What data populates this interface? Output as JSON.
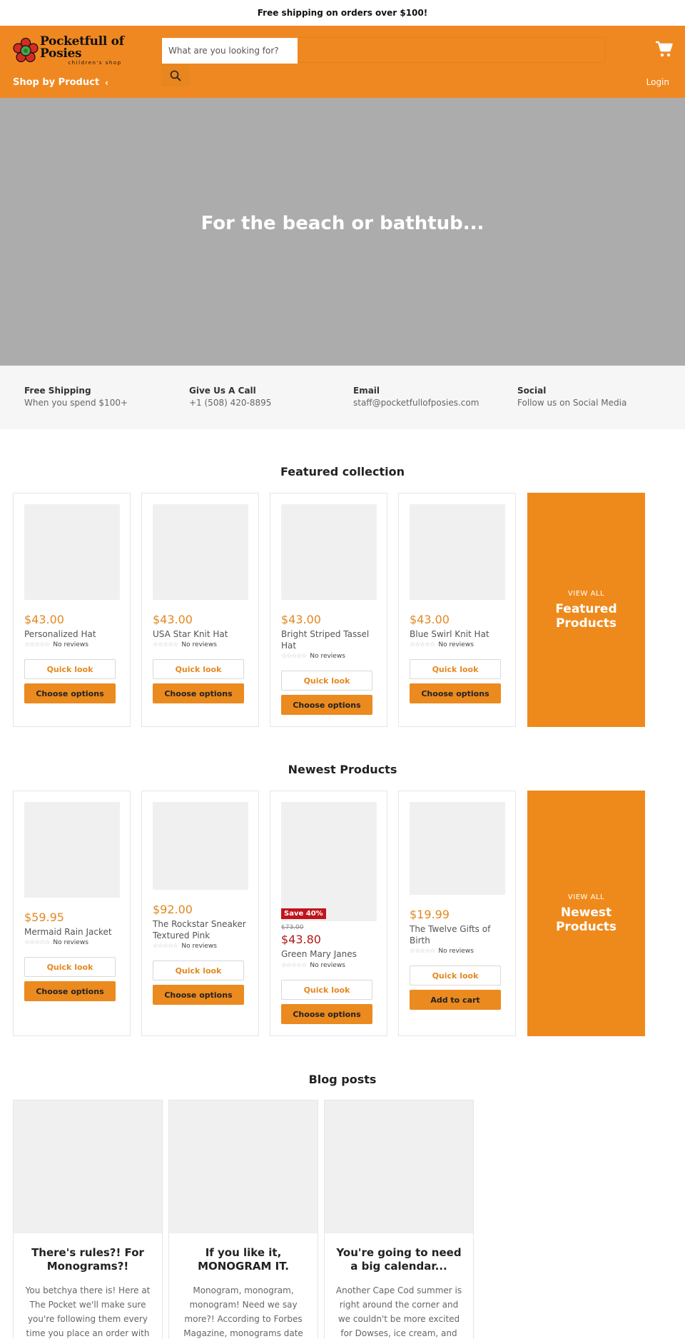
{
  "announcement": "Free shipping on orders over $100!",
  "header": {
    "logo_main": "Pocketfull of Posies",
    "logo_sub": "children's shop",
    "search_placeholder": "What are you looking for?",
    "nav_shop": "Shop by Product",
    "nav_login": "Login"
  },
  "hero": {
    "title": "For the beach or bathtub..."
  },
  "features": [
    {
      "title": "Free Shipping",
      "sub": "When you spend $100+"
    },
    {
      "title": "Give Us A Call",
      "sub": "+1 (508) 420-8895"
    },
    {
      "title": "Email",
      "sub": "staff@pocketfullofposies.com"
    },
    {
      "title": "Social",
      "sub": "Follow us on Social Media"
    }
  ],
  "featured": {
    "title": "Featured collection",
    "products": [
      {
        "price": "$43.00",
        "name": "Personalized Hat",
        "reviews": "No reviews",
        "quick": "Quick look",
        "action": "Choose options"
      },
      {
        "price": "$43.00",
        "name": "USA Star Knit Hat",
        "reviews": "No reviews",
        "quick": "Quick look",
        "action": "Choose options"
      },
      {
        "price": "$43.00",
        "name": "Bright Striped Tassel Hat",
        "reviews": "No reviews",
        "quick": "Quick look",
        "action": "Choose options"
      },
      {
        "price": "$43.00",
        "name": "Blue Swirl Knit Hat",
        "reviews": "No reviews",
        "quick": "Quick look",
        "action": "Choose options"
      }
    ],
    "promo_view_all": "VIEW ALL",
    "promo_title": "Featured Products"
  },
  "newest": {
    "title": "Newest Products",
    "products": [
      {
        "price": "$59.95",
        "name": "Mermaid Rain Jacket",
        "reviews": "No reviews",
        "quick": "Quick look",
        "action": "Choose options"
      },
      {
        "price": "$92.00",
        "name": "The Rockstar Sneaker Textured Pink",
        "reviews": "No reviews",
        "quick": "Quick look",
        "action": "Choose options"
      },
      {
        "badge": "Save 40%",
        "compare": "$73.00",
        "price": "$43.80",
        "name": "Green Mary Janes",
        "reviews": "No reviews",
        "quick": "Quick look",
        "action": "Choose options"
      },
      {
        "price": "$19.99",
        "name": "The Twelve Gifts of Birth",
        "reviews": "No reviews",
        "quick": "Quick look",
        "action": "Add to cart"
      }
    ],
    "promo_view_all": "VIEW ALL",
    "promo_title": "Newest Products"
  },
  "blog": {
    "title": "Blog posts",
    "posts": [
      {
        "title": "There's rules?! For Monograms?!",
        "excerpt": "You betchya there is! Here at The Pocket we'll make sure you're following them every time you place an order with"
      },
      {
        "title": "If you like it, MONOGRAM IT.",
        "excerpt": "Monogram, monogram, monogram! Need we say more?! According to Forbes Magazine, monograms date"
      },
      {
        "title": "You're going to need a big calendar...",
        "excerpt": "Another Cape Cod summer is right around the corner and we couldn't be more excited for Dowses, ice cream, and"
      }
    ]
  },
  "colors": {
    "brand_orange": "#f08821",
    "price_orange": "#e4881f",
    "sale_red": "#c1141b"
  },
  "icons": {
    "cart": "cart-icon",
    "search": "search-icon",
    "chevron": "chevron-left-icon",
    "logo": "flower-icon",
    "star": "star-icon"
  }
}
